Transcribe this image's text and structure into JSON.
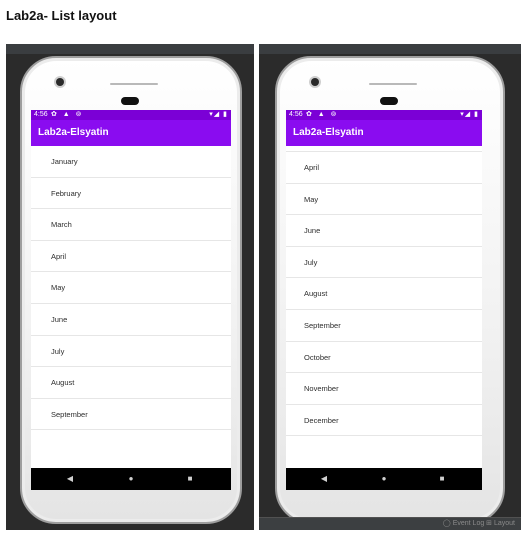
{
  "document": {
    "title": "Lab2a- List layout"
  },
  "colors": {
    "status_bar": "#7b00d6",
    "app_bar": "#8a0cf0",
    "nav_bar": "#000000"
  },
  "status_bar": {
    "time": "4:56",
    "left_icons": "✿ ▲ ⊚",
    "right_icons": "▾◢ ▮"
  },
  "app": {
    "title": "Lab2a-Elsyatin"
  },
  "nav": {
    "back": "◀",
    "home": "●",
    "recents": "■"
  },
  "screen_left": {
    "items": [
      "January",
      "February",
      "March",
      "April",
      "May",
      "June",
      "July",
      "August",
      "September"
    ]
  },
  "screen_right": {
    "items": [
      "April",
      "May",
      "June",
      "July",
      "August",
      "September",
      "October",
      "November",
      "December"
    ]
  },
  "footer_strip": {
    "text": "◯ Event Log   ⊞ Layout"
  }
}
